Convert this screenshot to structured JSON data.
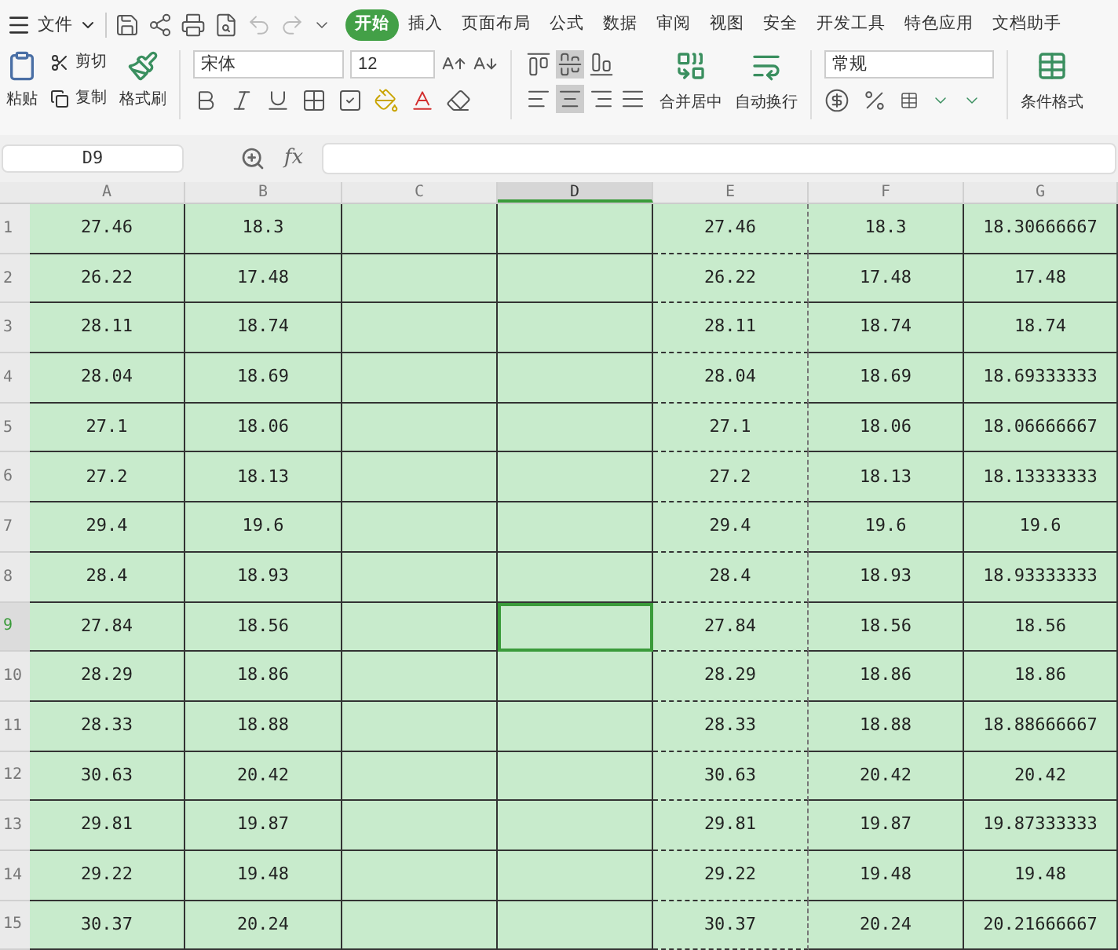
{
  "toolbar": {
    "file_menu": "文件",
    "tabs": [
      {
        "label": "开始",
        "selected": true
      },
      {
        "label": "插入",
        "selected": false
      },
      {
        "label": "页面布局",
        "selected": false
      },
      {
        "label": "公式",
        "selected": false
      },
      {
        "label": "数据",
        "selected": false
      },
      {
        "label": "审阅",
        "selected": false
      },
      {
        "label": "视图",
        "selected": false
      },
      {
        "label": "安全",
        "selected": false
      },
      {
        "label": "开发工具",
        "selected": false
      },
      {
        "label": "特色应用",
        "selected": false
      },
      {
        "label": "文档助手",
        "selected": false
      }
    ],
    "paste": "粘贴",
    "cut": "剪切",
    "copy": "复制",
    "format_painter": "格式刷",
    "font_name": "宋体",
    "font_size": "12",
    "vertical_align": [
      {
        "selected": false
      },
      {
        "selected": true
      },
      {
        "selected": false
      }
    ],
    "horizontal_align": [
      {
        "selected": false
      },
      {
        "selected": true
      },
      {
        "selected": false
      },
      {
        "selected": false
      }
    ],
    "merge": "合并居中",
    "wrap": "自动换行",
    "number_format": "常规",
    "conditional_format": "条件格式"
  },
  "name_box": "D9",
  "formula_label": "fx",
  "columns": [
    {
      "label": "A",
      "selected": false
    },
    {
      "label": "B",
      "selected": false
    },
    {
      "label": "C",
      "selected": false
    },
    {
      "label": "D",
      "selected": true
    },
    {
      "label": "E",
      "selected": false
    },
    {
      "label": "F",
      "selected": false
    },
    {
      "label": "G",
      "selected": false
    }
  ],
  "rows": [
    {
      "label": "1",
      "selected": false,
      "cells": [
        "27.46",
        "18.3",
        "",
        "",
        "27.46",
        "18.3",
        "18.30666667"
      ]
    },
    {
      "label": "2",
      "selected": false,
      "cells": [
        "26.22",
        "17.48",
        "",
        "",
        "26.22",
        "17.48",
        "17.48"
      ]
    },
    {
      "label": "3",
      "selected": false,
      "cells": [
        "28.11",
        "18.74",
        "",
        "",
        "28.11",
        "18.74",
        "18.74"
      ]
    },
    {
      "label": "4",
      "selected": false,
      "cells": [
        "28.04",
        "18.69",
        "",
        "",
        "28.04",
        "18.69",
        "18.69333333"
      ]
    },
    {
      "label": "5",
      "selected": false,
      "cells": [
        "27.1",
        "18.06",
        "",
        "",
        "27.1",
        "18.06",
        "18.06666667"
      ]
    },
    {
      "label": "6",
      "selected": false,
      "cells": [
        "27.2",
        "18.13",
        "",
        "",
        "27.2",
        "18.13",
        "18.13333333"
      ]
    },
    {
      "label": "7",
      "selected": false,
      "cells": [
        "29.4",
        "19.6",
        "",
        "",
        "29.4",
        "19.6",
        "19.6"
      ]
    },
    {
      "label": "8",
      "selected": false,
      "cells": [
        "28.4",
        "18.93",
        "",
        "",
        "28.4",
        "18.93",
        "18.93333333"
      ]
    },
    {
      "label": "9",
      "selected": true,
      "cells": [
        "27.84",
        "18.56",
        "",
        "",
        "27.84",
        "18.56",
        "18.56"
      ]
    },
    {
      "label": "10",
      "selected": false,
      "cells": [
        "28.29",
        "18.86",
        "",
        "",
        "28.29",
        "18.86",
        "18.86"
      ]
    },
    {
      "label": "11",
      "selected": false,
      "cells": [
        "28.33",
        "18.88",
        "",
        "",
        "28.33",
        "18.88",
        "18.88666667"
      ]
    },
    {
      "label": "12",
      "selected": false,
      "cells": [
        "30.63",
        "20.42",
        "",
        "",
        "30.63",
        "20.42",
        "20.42"
      ]
    },
    {
      "label": "13",
      "selected": false,
      "cells": [
        "29.81",
        "19.87",
        "",
        "",
        "29.81",
        "19.87",
        "19.87333333"
      ]
    },
    {
      "label": "14",
      "selected": false,
      "cells": [
        "29.22",
        "19.48",
        "",
        "",
        "29.22",
        "19.48",
        "19.48"
      ]
    },
    {
      "label": "15",
      "selected": false,
      "cells": [
        "30.37",
        "20.24",
        "",
        "",
        "30.37",
        "20.24",
        "20.21666667"
      ]
    }
  ]
}
